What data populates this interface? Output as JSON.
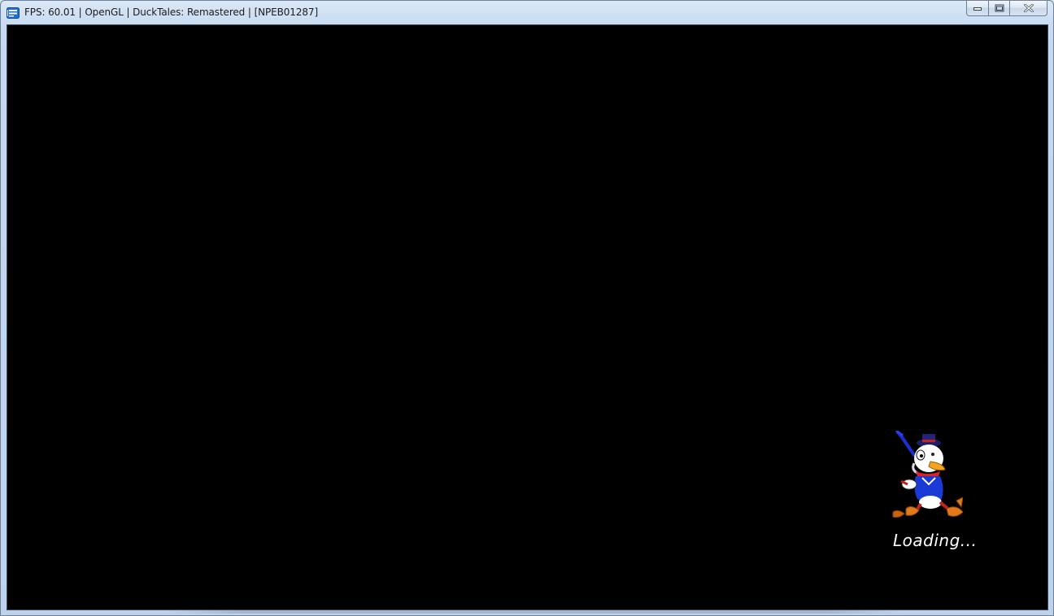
{
  "window": {
    "title": "FPS: 60.01 | OpenGL | DuckTales: Remastered | [NPEB01287]",
    "app_icon": "rpcs3-app-icon",
    "accent_color": "#1f6fd0"
  },
  "caption_buttons": {
    "minimize_icon": "minimize-icon",
    "maximize_icon": "maximize-icon",
    "close_icon": "close-icon"
  },
  "game": {
    "background_color": "#000000",
    "loading_text": "Loading...",
    "sprite": "scrooge-mcduck-pogo-cane-sprite"
  }
}
